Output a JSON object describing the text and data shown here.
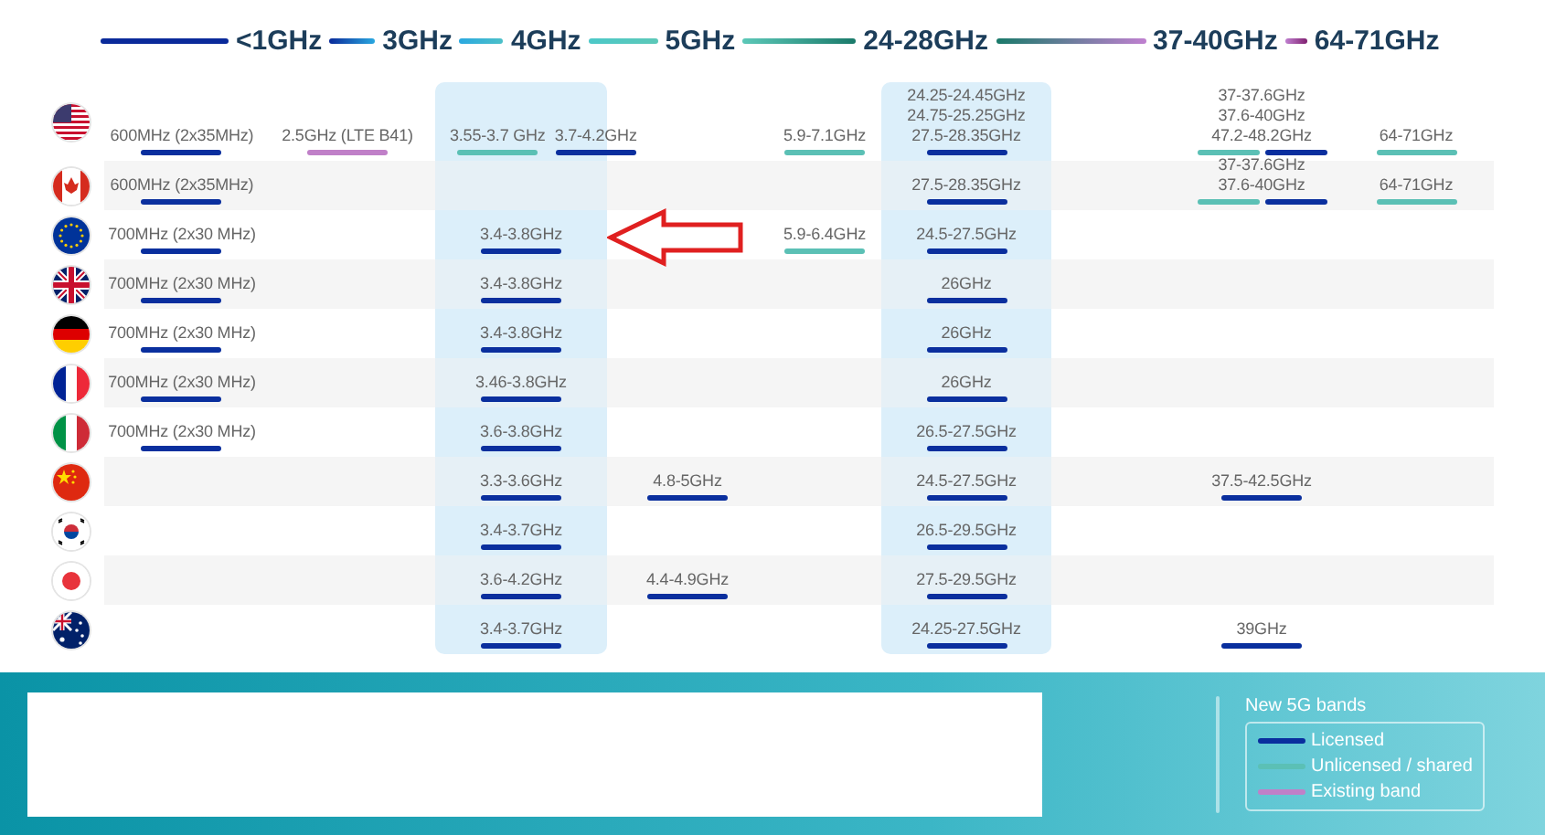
{
  "header": [
    "<1GHz",
    "3GHz",
    "4GHz",
    "5GHz",
    "24-28GHz",
    "37-40GHz",
    "64-71GHz"
  ],
  "rows": [
    {
      "kind": "us",
      "bands": {
        "sub_1ghz": [
          {
            "lines": [
              "600MHz (2x35MHz)"
            ],
            "bars": [
              {
                "kind": "licensed"
              }
            ]
          }
        ],
        "ghz_2_5": [
          {
            "lines": [
              "2.5GHz (LTE B41)"
            ],
            "bars": [
              {
                "kind": "existing"
              }
            ]
          }
        ],
        "ghz_3_4": [
          {
            "lines": [
              "3.55-3.7 GHz"
            ],
            "bars": [
              {
                "kind": "unlicensed"
              }
            ]
          },
          {
            "lines": [
              "3.7-4.2GHz"
            ],
            "bars": [
              {
                "kind": "licensed"
              }
            ]
          }
        ],
        "ghz_5_7": [
          {
            "lines": [
              "5.9-7.1GHz"
            ],
            "bars": [
              {
                "kind": "unlicensed"
              }
            ]
          }
        ],
        "ghz_24_28": [
          {
            "lines": [
              "24.25-24.45GHz",
              "24.75-25.25GHz",
              "27.5-28.35GHz"
            ],
            "bars": [
              {
                "kind": "licensed"
              }
            ]
          }
        ],
        "ghz_37_48": [
          {
            "lines": [
              "37-37.6GHz",
              "37.6-40GHz",
              "47.2-48.2GHz"
            ],
            "bars": [
              {
                "kind": "unlicensed"
              },
              {
                "kind": "licensed"
              }
            ]
          }
        ],
        "ghz_64_71": [
          {
            "lines": [
              "64-71GHz"
            ],
            "bars": [
              {
                "kind": "unlicensed"
              }
            ]
          }
        ]
      }
    },
    {
      "kind": "ca",
      "bands": {
        "sub_1ghz": [
          {
            "lines": [
              "600MHz (2x35MHz)"
            ],
            "bars": [
              {
                "kind": "licensed"
              }
            ]
          }
        ],
        "ghz_24_28": [
          {
            "lines": [
              "27.5-28.35GHz"
            ],
            "bars": [
              {
                "kind": "licensed"
              }
            ]
          }
        ],
        "ghz_37_48": [
          {
            "lines": [
              "37-37.6GHz",
              "37.6-40GHz"
            ],
            "bars": [
              {
                "kind": "unlicensed"
              },
              {
                "kind": "licensed"
              }
            ]
          }
        ],
        "ghz_64_71": [
          {
            "lines": [
              "64-71GHz"
            ],
            "bars": [
              {
                "kind": "unlicensed"
              }
            ]
          }
        ]
      }
    },
    {
      "kind": "eu",
      "bands": {
        "sub_1ghz": [
          {
            "lines": [
              "700MHz (2x30 MHz)"
            ],
            "bars": [
              {
                "kind": "licensed"
              }
            ]
          }
        ],
        "ghz_3_4": [
          {
            "lines": [
              "3.4-3.8GHz"
            ],
            "bars": [
              {
                "kind": "licensed"
              }
            ]
          }
        ],
        "ghz_5_7": [
          {
            "lines": [
              "5.9-6.4GHz"
            ],
            "bars": [
              {
                "kind": "unlicensed"
              }
            ]
          }
        ],
        "ghz_24_28": [
          {
            "lines": [
              "24.5-27.5GHz"
            ],
            "bars": [
              {
                "kind": "licensed"
              }
            ]
          }
        ]
      }
    },
    {
      "kind": "gb",
      "bands": {
        "sub_1ghz": [
          {
            "lines": [
              "700MHz (2x30 MHz)"
            ],
            "bars": [
              {
                "kind": "licensed"
              }
            ]
          }
        ],
        "ghz_3_4": [
          {
            "lines": [
              "3.4-3.8GHz"
            ],
            "bars": [
              {
                "kind": "licensed"
              }
            ]
          }
        ],
        "ghz_24_28": [
          {
            "lines": [
              "26GHz"
            ],
            "bars": [
              {
                "kind": "licensed"
              }
            ]
          }
        ]
      }
    },
    {
      "kind": "de",
      "bands": {
        "sub_1ghz": [
          {
            "lines": [
              "700MHz (2x30 MHz)"
            ],
            "bars": [
              {
                "kind": "licensed"
              }
            ]
          }
        ],
        "ghz_3_4": [
          {
            "lines": [
              "3.4-3.8GHz"
            ],
            "bars": [
              {
                "kind": "licensed"
              }
            ]
          }
        ],
        "ghz_24_28": [
          {
            "lines": [
              "26GHz"
            ],
            "bars": [
              {
                "kind": "licensed"
              }
            ]
          }
        ]
      }
    },
    {
      "kind": "fr",
      "bands": {
        "sub_1ghz": [
          {
            "lines": [
              "700MHz (2x30 MHz)"
            ],
            "bars": [
              {
                "kind": "licensed"
              }
            ]
          }
        ],
        "ghz_3_4": [
          {
            "lines": [
              "3.46-3.8GHz"
            ],
            "bars": [
              {
                "kind": "licensed"
              }
            ]
          }
        ],
        "ghz_24_28": [
          {
            "lines": [
              "26GHz"
            ],
            "bars": [
              {
                "kind": "licensed"
              }
            ]
          }
        ]
      }
    },
    {
      "kind": "it",
      "bands": {
        "sub_1ghz": [
          {
            "lines": [
              "700MHz (2x30 MHz)"
            ],
            "bars": [
              {
                "kind": "licensed"
              }
            ]
          }
        ],
        "ghz_3_4": [
          {
            "lines": [
              "3.6-3.8GHz"
            ],
            "bars": [
              {
                "kind": "licensed"
              }
            ]
          }
        ],
        "ghz_24_28": [
          {
            "lines": [
              "26.5-27.5GHz"
            ],
            "bars": [
              {
                "kind": "licensed"
              }
            ]
          }
        ]
      }
    },
    {
      "kind": "cn",
      "bands": {
        "ghz_3_4": [
          {
            "lines": [
              "3.3-3.6GHz"
            ],
            "bars": [
              {
                "kind": "licensed"
              }
            ]
          }
        ],
        "ghz_4_5": [
          {
            "lines": [
              "4.8-5GHz"
            ],
            "bars": [
              {
                "kind": "licensed"
              }
            ]
          }
        ],
        "ghz_24_28": [
          {
            "lines": [
              "24.5-27.5GHz"
            ],
            "bars": [
              {
                "kind": "licensed"
              }
            ]
          }
        ],
        "ghz_37_48": [
          {
            "lines": [
              "37.5-42.5GHz"
            ],
            "bars": [
              {
                "kind": "licensed"
              }
            ]
          }
        ]
      }
    },
    {
      "kind": "kr",
      "bands": {
        "ghz_3_4": [
          {
            "lines": [
              "3.4-3.7GHz"
            ],
            "bars": [
              {
                "kind": "licensed"
              }
            ]
          }
        ],
        "ghz_24_28": [
          {
            "lines": [
              "26.5-29.5GHz"
            ],
            "bars": [
              {
                "kind": "licensed"
              }
            ]
          }
        ]
      }
    },
    {
      "kind": "jp",
      "bands": {
        "ghz_3_4": [
          {
            "lines": [
              "3.6-4.2GHz"
            ],
            "bars": [
              {
                "kind": "licensed"
              }
            ]
          }
        ],
        "ghz_4_5": [
          {
            "lines": [
              "4.4-4.9GHz"
            ],
            "bars": [
              {
                "kind": "licensed"
              }
            ]
          }
        ],
        "ghz_24_28": [
          {
            "lines": [
              "27.5-29.5GHz"
            ],
            "bars": [
              {
                "kind": "licensed"
              }
            ]
          }
        ]
      }
    },
    {
      "kind": "au",
      "bands": {
        "ghz_3_4": [
          {
            "lines": [
              "3.4-3.7GHz"
            ],
            "bars": [
              {
                "kind": "licensed"
              }
            ]
          }
        ],
        "ghz_24_28": [
          {
            "lines": [
              "24.25-27.5GHz"
            ],
            "bars": [
              {
                "kind": "licensed"
              }
            ]
          }
        ],
        "ghz_37_48": [
          {
            "lines": [
              "39GHz"
            ],
            "bars": [
              {
                "kind": "licensed"
              }
            ]
          }
        ]
      }
    }
  ],
  "legend": {
    "title": "New 5G bands",
    "items": [
      {
        "label": "Licensed",
        "kind": "licensed"
      },
      {
        "label": "Unlicensed / shared",
        "kind": "unlicensed"
      },
      {
        "label": "Existing band",
        "kind": "existing"
      }
    ]
  }
}
